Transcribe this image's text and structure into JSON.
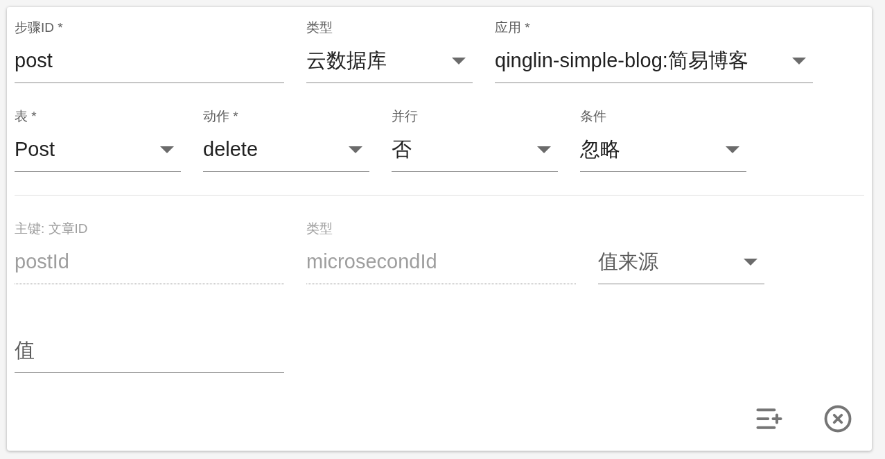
{
  "step_fields": [
    {
      "kind": "text",
      "label": "步骤ID *",
      "value": "post",
      "disabled": false
    },
    {
      "kind": "select",
      "label": "类型",
      "value": "云数据库",
      "disabled": false
    },
    {
      "kind": "select",
      "label": "应用 *",
      "value": "qinglin-simple-blog:简易博客",
      "disabled": false
    }
  ],
  "table_fields": [
    {
      "kind": "select",
      "label": "表 *",
      "value": "Post",
      "disabled": false
    },
    {
      "kind": "select",
      "label": "动作 *",
      "value": "delete",
      "disabled": false
    },
    {
      "kind": "select",
      "label": "并行",
      "value": "否",
      "disabled": false
    },
    {
      "kind": "select",
      "label": "条件",
      "value": "忽略",
      "disabled": false
    }
  ],
  "key_fields": [
    {
      "kind": "text",
      "label": "主键: 文章ID",
      "value": "postId",
      "disabled": true
    },
    {
      "kind": "text",
      "label": "类型",
      "value": "microsecondId",
      "disabled": true
    },
    {
      "kind": "select",
      "placeholder": "值来源",
      "disabled": false
    }
  ],
  "value_fields": [
    {
      "kind": "text",
      "placeholder": "值",
      "disabled": false
    }
  ]
}
